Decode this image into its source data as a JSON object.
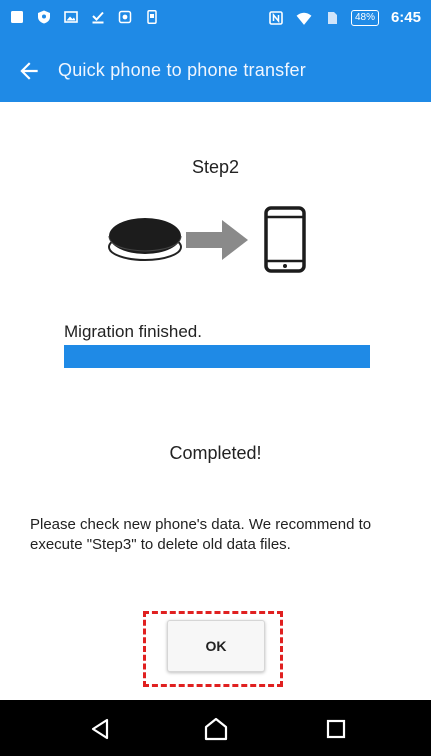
{
  "status_bar": {
    "battery_level": "48%",
    "time": "6:45",
    "icons": [
      "notification-square-icon",
      "shield-icon",
      "image-icon",
      "download-done-icon",
      "camera-icon",
      "phone-outline-icon",
      "nfc-icon",
      "wifi-icon",
      "sim-icon",
      "battery-icon"
    ]
  },
  "app_bar": {
    "title": "Quick phone to phone transfer",
    "back_icon": "back-arrow-icon",
    "color": "#1f8ae6"
  },
  "main": {
    "step_label": "Step2",
    "illustration": {
      "source_icon": "round-device-icon",
      "arrow_icon": "arrow-right-icon",
      "target_icon": "smartphone-icon"
    },
    "progress": {
      "label": "Migration finished.",
      "value_percent": 100,
      "color": "#1f8ae6"
    },
    "completed_text": "Completed!",
    "message": "Please check new phone's data. We recommend to execute \"Step3\" to delete old data files.",
    "ok_label": "OK",
    "highlight_color": "#e02020"
  },
  "nav_bar": {
    "items": [
      "back-triangle-icon",
      "home-icon",
      "recents-square-icon"
    ]
  }
}
